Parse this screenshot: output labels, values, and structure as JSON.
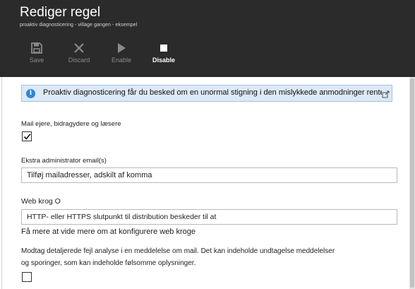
{
  "header": {
    "title": "Rediger regel",
    "subtitle": "proaktiv diagnosticering - village gangen - eksempel"
  },
  "toolbar": {
    "save": {
      "label": "Save",
      "icon": "save-icon"
    },
    "discard": {
      "label": "Discard",
      "icon": "close-icon"
    },
    "enable": {
      "label": "Enable",
      "icon": "play-icon"
    },
    "disable": {
      "label": "Disable",
      "icon": "stop-icon"
    }
  },
  "info_banner": {
    "text": "Proaktiv diagnosticering får du besked om en unormal stigning i den mislykkede anmodninger rente"
  },
  "form": {
    "mail_owners": {
      "label": "Mail ejere, bidragydere og læsere",
      "checked": true
    },
    "extra_email": {
      "label": "Ekstra administrator email(s)",
      "value": "Tilføj mailadresser, adskilt af komma"
    },
    "webhook": {
      "label": "Web krog O",
      "value": "HTTP- eller HTTPS slutpunkt til distribution beskeder til at",
      "link": "Få mere at vide mere om at konfigurere web kroge"
    },
    "detailed": {
      "line1": "Modtag detaljerede fejl analyse i en meddelelse om mail. Det kan indeholde undtagelse meddelelser",
      "line2": "og sporinger, som kan indeholde følsomme oplysninger.",
      "checked": false
    }
  },
  "colors": {
    "header_bg": "#2b2b2b",
    "banner_bg": "#dde9f6",
    "info_icon": "#2e86d6"
  }
}
